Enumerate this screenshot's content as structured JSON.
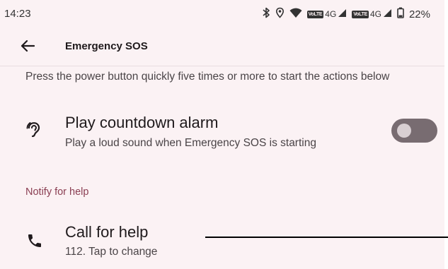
{
  "status_bar": {
    "time": "14:23",
    "battery": "22%",
    "net1": "4G",
    "net2": "4G",
    "volte": "VoLTE",
    "icons": [
      "bluetooth-icon",
      "location-icon",
      "wifi-icon",
      "signal-icon",
      "signal-icon",
      "battery-icon"
    ]
  },
  "appbar": {
    "title": "Emergency SOS"
  },
  "intro": "Press the power button quickly five times or more to start the actions below",
  "alarm": {
    "title": "Play countdown alarm",
    "subtitle": "Play a loud sound when Emergency SOS is starting",
    "icon": "hearing-icon",
    "toggle_on": false
  },
  "section_header": "Notify for help",
  "call": {
    "title": "Call for help",
    "subtitle": "112. Tap to change",
    "icon": "phone-icon"
  },
  "colors": {
    "background": "#fbf2f4",
    "accent": "#8a3e52",
    "toggle_track": "#786c71"
  }
}
